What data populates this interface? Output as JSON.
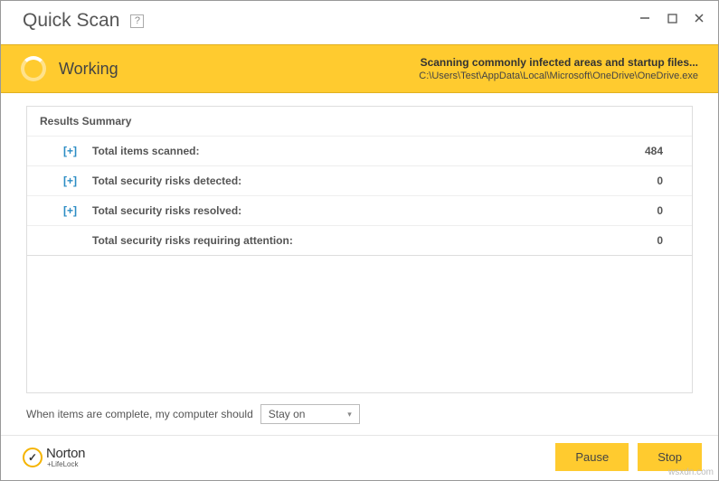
{
  "titlebar": {
    "title": "Quick Scan",
    "help": "?"
  },
  "status": {
    "label": "Working",
    "heading": "Scanning commonly infected areas and startup files...",
    "path": "C:\\Users\\Test\\AppData\\Local\\Microsoft\\OneDrive\\OneDrive.exe"
  },
  "results": {
    "header": "Results Summary",
    "rows": [
      {
        "toggle": "[+]",
        "label": "Total items scanned:",
        "value": "484"
      },
      {
        "toggle": "[+]",
        "label": "Total security risks detected:",
        "value": "0"
      },
      {
        "toggle": "[+]",
        "label": "Total security risks resolved:",
        "value": "0"
      },
      {
        "toggle": "",
        "label": "Total security risks requiring attention:",
        "value": "0"
      }
    ]
  },
  "completion": {
    "prompt": "When items are complete, my computer should",
    "selected": "Stay on"
  },
  "footer": {
    "logo_name": "Norton",
    "logo_sub": "+LifeLock",
    "pause": "Pause",
    "stop": "Stop"
  },
  "watermark": "wsxdn.com"
}
